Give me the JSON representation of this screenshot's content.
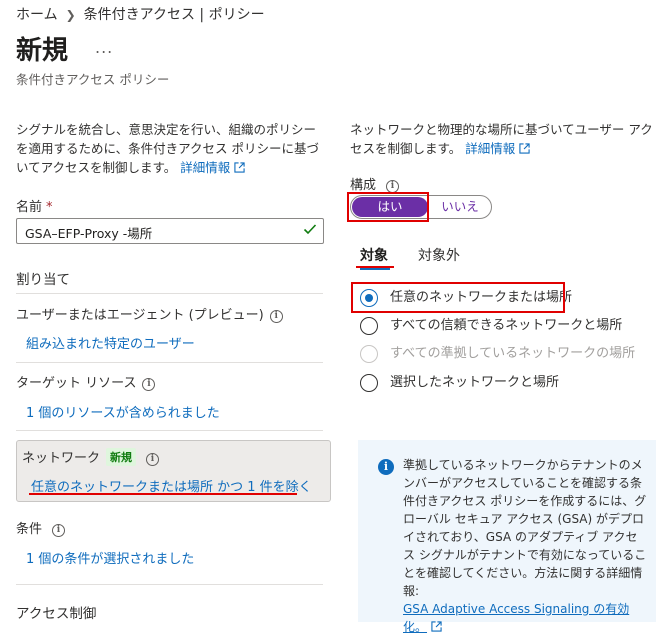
{
  "breadcrumb": {
    "home": "ホーム",
    "current": "条件付きアクセス | ポリシー"
  },
  "header": {
    "title": "新規",
    "more": "...",
    "subtitle": "条件付きアクセス ポリシー"
  },
  "description": {
    "text": "シグナルを統合し、意思決定を行い、組織のポリシーを適用するために、条件付きアクセス ポリシーに基づいてアクセスを制御します。",
    "link": "詳細情報"
  },
  "name_field": {
    "label": "名前",
    "required_mark": "*",
    "value": "GSA–EFP-Proxy -場所"
  },
  "assignments": {
    "title": "割り当て",
    "users": {
      "label": "ユーザーまたはエージェント (プレビュー)",
      "link": "組み込まれた特定のユーザー"
    },
    "target": {
      "label": "ターゲット リソース",
      "link": "1 個のリソースが含められました"
    },
    "network": {
      "label": "ネットワーク",
      "badge": "新規",
      "link": "任意のネットワークまたは場所 かつ 1 件を除く"
    },
    "conditions": {
      "label": "条件",
      "link": "1 個の条件が選択されました"
    },
    "access_controls": {
      "label": "アクセス制御"
    }
  },
  "right": {
    "description": "ネットワークと物理的な場所に基づいてユーザー アクセスを制御します。",
    "link": "詳細情報",
    "config_label": "構成",
    "toggle": {
      "yes": "はい",
      "no": "いいえ",
      "selected": "yes"
    },
    "tabs": [
      {
        "label": "対象",
        "active": true
      },
      {
        "label": "対象外",
        "active": false
      }
    ],
    "options": [
      {
        "label": "任意のネットワークまたは場所",
        "state": "selected"
      },
      {
        "label": "すべての信頼できるネットワークと場所",
        "state": "unselected"
      },
      {
        "label": "すべての準拠しているネットワークの場所",
        "state": "disabled"
      },
      {
        "label": "選択したネットワークと場所",
        "state": "unselected"
      }
    ],
    "info": {
      "text": "準拠しているネットワークからテナントのメンバーがアクセスしていることを確認する条件付きアクセス ポリシーを作成するには、グローバル セキュア アクセス (GSA) がデプロイされており、GSA のアダプティブ アクセス シグナルがテナントで有効になっていることを確認してください。方法に関する詳細情報:",
      "link": "GSA Adaptive Access Signaling の有効化。"
    }
  },
  "colors": {
    "accent": "#0f6cbd",
    "toggle_selected": "#6b2fa6",
    "highlight": "#e00000",
    "badge_bg": "#dff6dd",
    "badge_text": "#107c10"
  }
}
